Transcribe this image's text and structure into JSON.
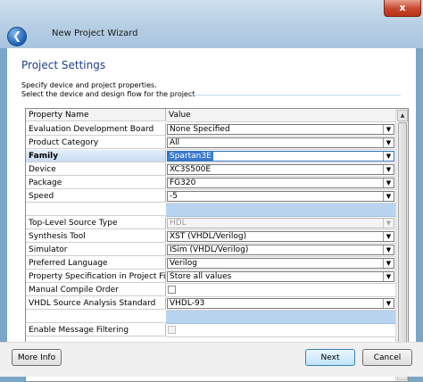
{
  "window": {
    "title": "New Project Wizard",
    "close_label": "x",
    "back_icon": "back-arrow-icon"
  },
  "page": {
    "title": "Project Settings",
    "instruction_1": "Specify device and project properties.",
    "instruction_2": "Select the device and design flow for the project"
  },
  "grid": {
    "headers": {
      "name": "Property Name",
      "value": "Value"
    },
    "rows": [
      {
        "name": "Evaluation Development Board",
        "type": "dropdown",
        "value": "None Specified"
      },
      {
        "name": "Product Category",
        "type": "dropdown",
        "value": "All"
      },
      {
        "name": "Family",
        "type": "dropdown",
        "value": "Spartan3E",
        "selected": true
      },
      {
        "name": "Device",
        "type": "dropdown",
        "value": "XC3S500E"
      },
      {
        "name": "Package",
        "type": "dropdown",
        "value": "FG320"
      },
      {
        "name": "Speed",
        "type": "dropdown",
        "value": "-5"
      },
      {
        "name": "",
        "type": "separator",
        "value": ""
      },
      {
        "name": "Top-Level Source Type",
        "type": "dropdown-disabled",
        "value": "HDL"
      },
      {
        "name": "Synthesis Tool",
        "type": "dropdown",
        "value": "XST (VHDL/Verilog)"
      },
      {
        "name": "Simulator",
        "type": "dropdown",
        "value": "ISim (VHDL/Verilog)"
      },
      {
        "name": "Preferred Language",
        "type": "dropdown",
        "value": "Verilog"
      },
      {
        "name": "Property Specification in Project File",
        "type": "dropdown",
        "value": "Store all values"
      },
      {
        "name": "Manual Compile Order",
        "type": "checkbox",
        "value": ""
      },
      {
        "name": "VHDL Source Analysis Standard",
        "type": "dropdown",
        "value": "VHDL-93"
      },
      {
        "name": "",
        "type": "separator",
        "value": ""
      },
      {
        "name": "Enable Message Filtering",
        "type": "checkbox-disabled",
        "value": ""
      }
    ]
  },
  "footer": {
    "more_info": "More Info",
    "next": "Next",
    "cancel": "Cancel"
  },
  "colors": {
    "accent": "#3a7bd0",
    "title_text": "#1e3f8a",
    "separator": "#b8d4ef"
  }
}
